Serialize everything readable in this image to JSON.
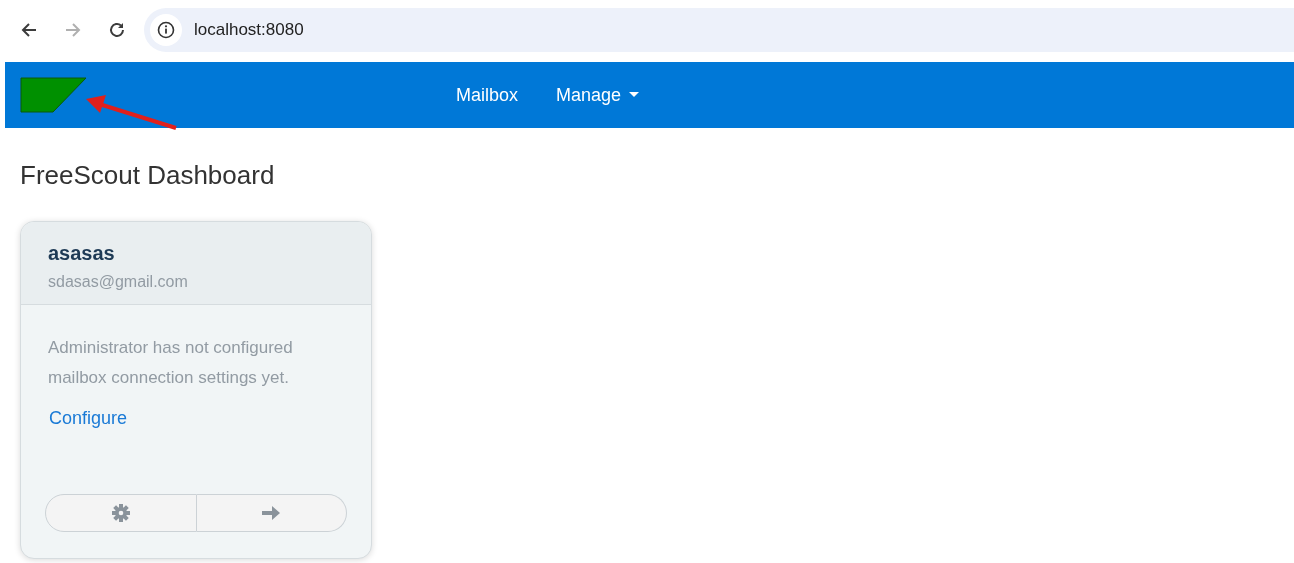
{
  "browser": {
    "url": "localhost:8080",
    "back": {
      "disabled": false
    },
    "forward": {
      "disabled": true
    }
  },
  "navbar": {
    "items": [
      {
        "label": "Mailbox",
        "kind": "link"
      },
      {
        "label": "Manage",
        "kind": "dropdown"
      }
    ]
  },
  "page_title": "FreeScout Dashboard",
  "mailboxes": [
    {
      "name": "asasas",
      "email": "sdasas@gmail.com",
      "message": "Administrator has not configured mailbox connection settings yet.",
      "action": "Configure"
    }
  ]
}
